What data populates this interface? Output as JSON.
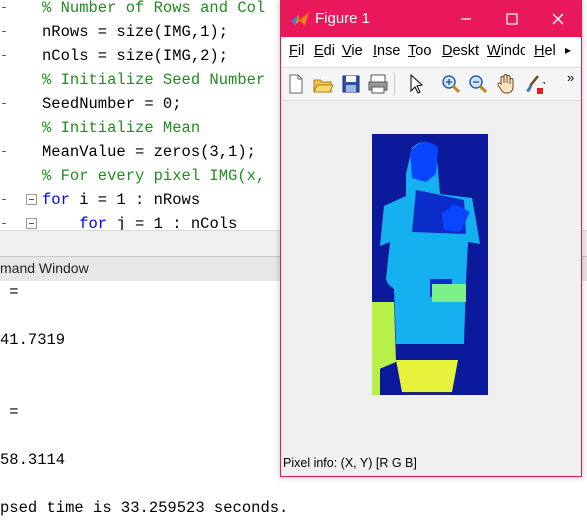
{
  "editor": {
    "lines": [
      {
        "mark": "-",
        "fold": false,
        "cls": "c-comment",
        "text": "% Number of Rows and Col"
      },
      {
        "mark": "-",
        "fold": false,
        "cls": "c-normal",
        "text": "nRows = size(IMG,1);"
      },
      {
        "mark": "-",
        "fold": false,
        "cls": "c-normal",
        "text": "nCols = size(IMG,2);"
      },
      {
        "mark": "",
        "fold": false,
        "cls": "c-comment",
        "text": "% Initialize Seed Number"
      },
      {
        "mark": "-",
        "fold": false,
        "cls": "c-normal",
        "text": "SeedNumber = 0;"
      },
      {
        "mark": "",
        "fold": false,
        "cls": "c-comment",
        "text": "% Initialize Mean"
      },
      {
        "mark": "-",
        "fold": false,
        "cls": "c-normal",
        "text": "MeanValue = zeros(3,1);"
      },
      {
        "mark": "",
        "fold": false,
        "cls": "c-comment",
        "text": "% For every pixel IMG(x,"
      },
      {
        "mark": "-",
        "fold": true,
        "cls": "c-kw",
        "text": "for",
        "rest": " i = 1 : nRows"
      },
      {
        "mark": "-",
        "fold": true,
        "cls": "c-kw",
        "text": "    for",
        "rest": " j = 1 : nCols"
      }
    ]
  },
  "command_window": {
    "title": "mand Window",
    "lines": [
      " =",
      "",
      "41.7319",
      "",
      "",
      " =",
      "",
      "58.3114",
      "",
      "psed time is 33.259523 seconds."
    ]
  },
  "figure": {
    "title": "Figure 1",
    "title_color": "#e8185a",
    "menu": [
      "File",
      "Edit",
      "View",
      "Insert",
      "Tools",
      "Desktop",
      "Window",
      "Help"
    ],
    "menu_visible": [
      "Fil",
      "Edi",
      "Vie",
      "Inse",
      "Too",
      "Deskt",
      "Windo",
      "Hel"
    ],
    "status": "Pixel info: (X, Y)  [R G B]",
    "toolbar_icons": [
      "new-figure-icon",
      "open-file-icon",
      "save-icon",
      "print-icon",
      "pointer-icon",
      "zoom-in-icon",
      "zoom-out-icon",
      "pan-hand-icon",
      "brush-icon"
    ],
    "image_colors": {
      "background": "#0a1a9a",
      "body": "#14b0f0",
      "head": "#0a46ff",
      "top": "#0a2cc8",
      "lime": "#b8f04a",
      "yellow": "#e6f23c",
      "green_patch": "#7cf08a",
      "dark": "#1a2a6a"
    }
  }
}
